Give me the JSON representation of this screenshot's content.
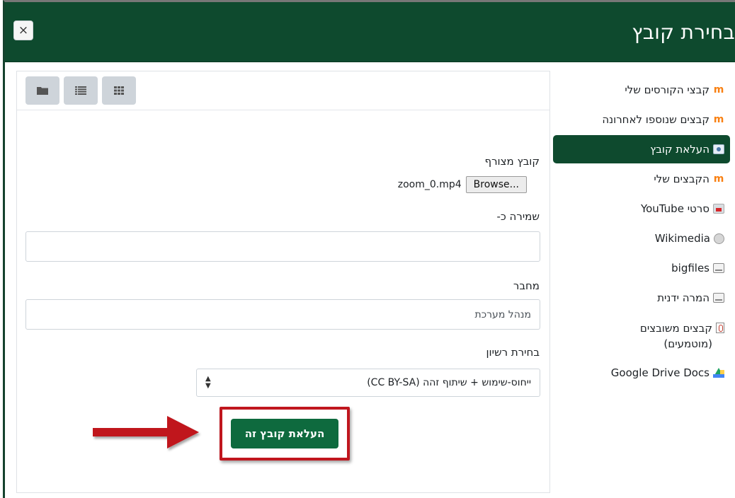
{
  "header": {
    "title": "בחירת קובץ",
    "close_glyph": "×"
  },
  "sidebar": {
    "items": [
      {
        "label": "קבצי הקורסים שלי",
        "icon": "moodle-icon",
        "active": false
      },
      {
        "label": "קבצים שנוספו לאחרונה",
        "icon": "moodle-icon",
        "active": false
      },
      {
        "label": "העלאת קובץ",
        "icon": "upload-icon",
        "active": true
      },
      {
        "label": "הקבצים שלי",
        "icon": "moodle-icon",
        "active": false
      },
      {
        "label": "סרטי YouTube",
        "icon": "youtube-icon",
        "active": false
      },
      {
        "label": "Wikimedia",
        "icon": "wikimedia-icon",
        "active": false
      },
      {
        "label": "bigfiles",
        "icon": "disk-icon",
        "active": false
      },
      {
        "label": "המרה ידנית",
        "icon": "disk-icon",
        "active": false
      },
      {
        "label": "קבצים משובצים (מוטמעים)",
        "icon": "clip-icon",
        "active": false
      },
      {
        "label": "Google Drive Docs",
        "icon": "google-drive-icon",
        "active": false
      }
    ]
  },
  "toolbar": {
    "views": [
      "folder-view-icon",
      "list-view-icon",
      "grid-view-icon"
    ]
  },
  "form": {
    "attachment_label": "קובץ מצורף",
    "browse_label": "Browse...",
    "file_name": "zoom_0.mp4",
    "save_as_label": "שמירה כ-",
    "save_as_value": "",
    "author_label": "מחבר",
    "author_value": "מנהל מערכת",
    "license_label": "בחירת רשיון",
    "license_value": "ייחוס-שימוש + שיתוף זהה (CC BY-SA)",
    "upload_button": "העלאת קובץ זה"
  },
  "colors": {
    "header_bg": "#0e4a2e",
    "active_bg": "#0e4a2e",
    "button_bg": "#0e6a3e",
    "highlight_red": "#c0161e"
  }
}
